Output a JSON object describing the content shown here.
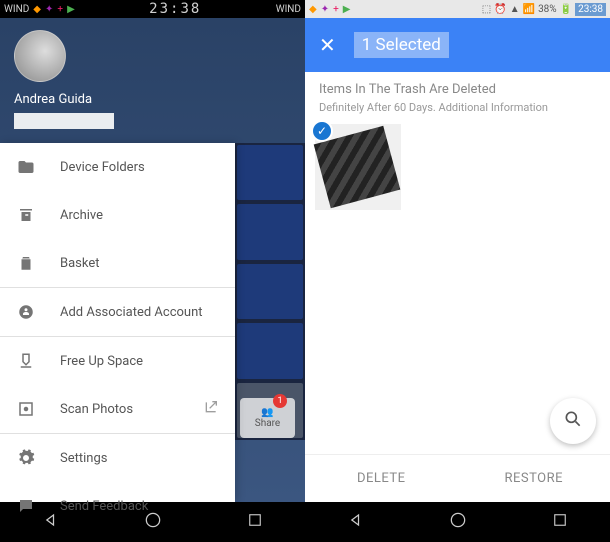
{
  "left_status": {
    "carrier": "WIND",
    "clock": "23:38",
    "carrier_right": "WIND"
  },
  "right_status": {
    "battery": "38%",
    "clock": "23:38"
  },
  "user": {
    "name": "Andrea Guida"
  },
  "drawer": {
    "device_folders": "Device Folders",
    "archive": "Archive",
    "basket": "Basket",
    "add_account": "Add Associated Account",
    "free_space": "Free Up Space",
    "scan_photos": "Scan Photos",
    "settings": "Settings",
    "feedback": "Send Feedback"
  },
  "share": {
    "label": "Share",
    "badge": "1"
  },
  "selection": {
    "count_label": "1 Selected"
  },
  "trash": {
    "title": "Items In The Trash Are Deleted",
    "subtitle": "Definitely After 60 Days. Additional Information"
  },
  "actions": {
    "delete": "DELETE",
    "restore": "RESTORE"
  }
}
